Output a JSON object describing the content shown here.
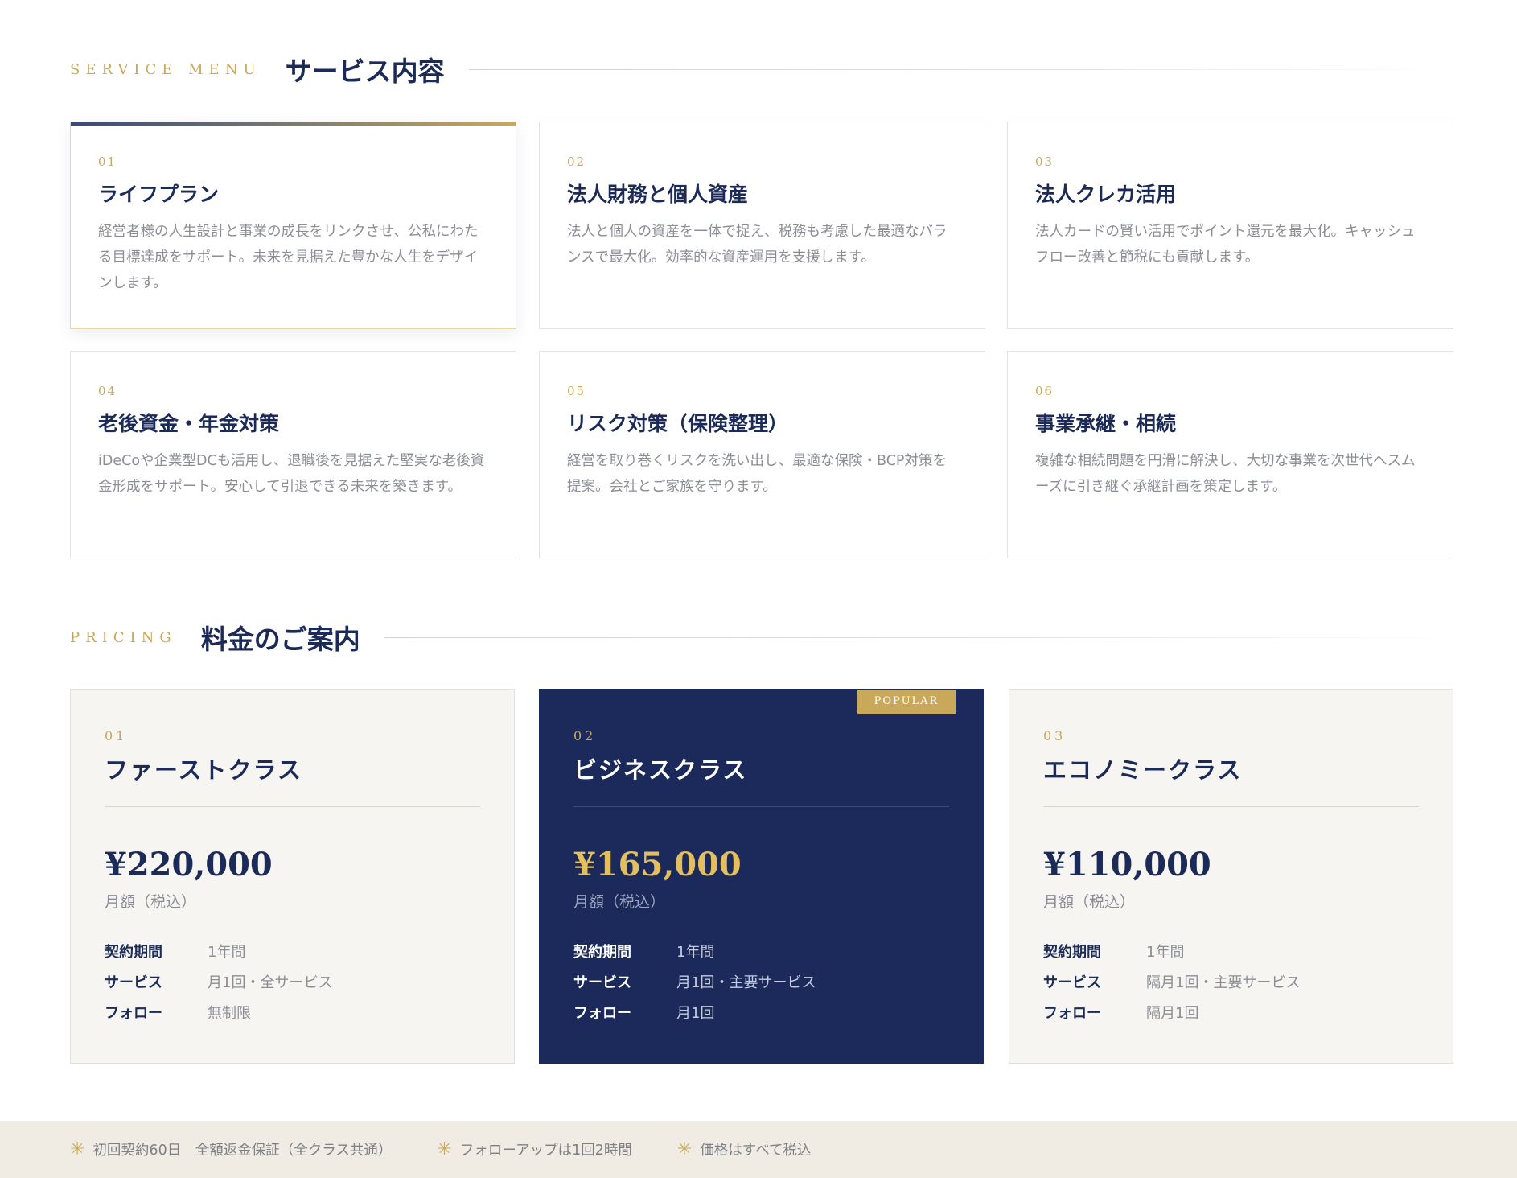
{
  "service_section": {
    "en_label": "SERVICE MENU",
    "title": "サービス内容"
  },
  "services": [
    {
      "num": "01",
      "title": "ライフプラン",
      "desc": "経営者様の人生設計と事業の成長をリンクさせ、公私にわたる目標達成をサポート。未来を見据えた豊かな人生をデザインします。"
    },
    {
      "num": "02",
      "title": "法人財務と個人資産",
      "desc": "法人と個人の資産を一体で捉え、税務も考慮した最適なバランスで最大化。効率的な資産運用を支援します。"
    },
    {
      "num": "03",
      "title": "法人クレカ活用",
      "desc": "法人カードの賢い活用でポイント還元を最大化。キャッシュフロー改善と節税にも貢献します。"
    },
    {
      "num": "04",
      "title": "老後資金・年金対策",
      "desc": "iDeCoや企業型DCも活用し、退職後を見据えた堅実な老後資金形成をサポート。安心して引退できる未来を築きます。"
    },
    {
      "num": "05",
      "title": "リスク対策（保険整理）",
      "desc": "経営を取り巻くリスクを洗い出し、最適な保険・BCP対策を提案。会社とご家族を守ります。"
    },
    {
      "num": "06",
      "title": "事業承継・相続",
      "desc": "複雑な相続問題を円滑に解決し、大切な事業を次世代へスムーズに引き継ぐ承継計画を策定します。"
    }
  ],
  "pricing_section": {
    "en_label": "PRICING",
    "title": "料金のご案内"
  },
  "plans": [
    {
      "num": "01",
      "title": "ファーストクラス",
      "price": "¥220,000",
      "unit": "月額（税込）",
      "rows": [
        {
          "k": "契約期間",
          "v": "1年間"
        },
        {
          "k": "サービス",
          "v": "月1回・全サービス"
        },
        {
          "k": "フォロー",
          "v": "無制限"
        }
      ]
    },
    {
      "num": "02",
      "title": "ビジネスクラス",
      "price": "¥165,000",
      "unit": "月額（税込）",
      "badge": "POPULAR",
      "rows": [
        {
          "k": "契約期間",
          "v": "1年間"
        },
        {
          "k": "サービス",
          "v": "月1回・主要サービス"
        },
        {
          "k": "フォロー",
          "v": "月1回"
        }
      ]
    },
    {
      "num": "03",
      "title": "エコノミークラス",
      "price": "¥110,000",
      "unit": "月額（税込）",
      "rows": [
        {
          "k": "契約期間",
          "v": "1年間"
        },
        {
          "k": "サービス",
          "v": "隔月1回・主要サービス"
        },
        {
          "k": "フォロー",
          "v": "隔月1回"
        }
      ]
    }
  ],
  "footer_notes": [
    "初回契約60日　全額返金保証（全クラス共通）",
    "フォローアップは1回2時間",
    "価格はすべて税込"
  ],
  "colors": {
    "navy": "#1b2a57",
    "gold": "#c9a85a",
    "featured_bg": "#1b2a5a",
    "card_bg": "#f6f5f1"
  }
}
